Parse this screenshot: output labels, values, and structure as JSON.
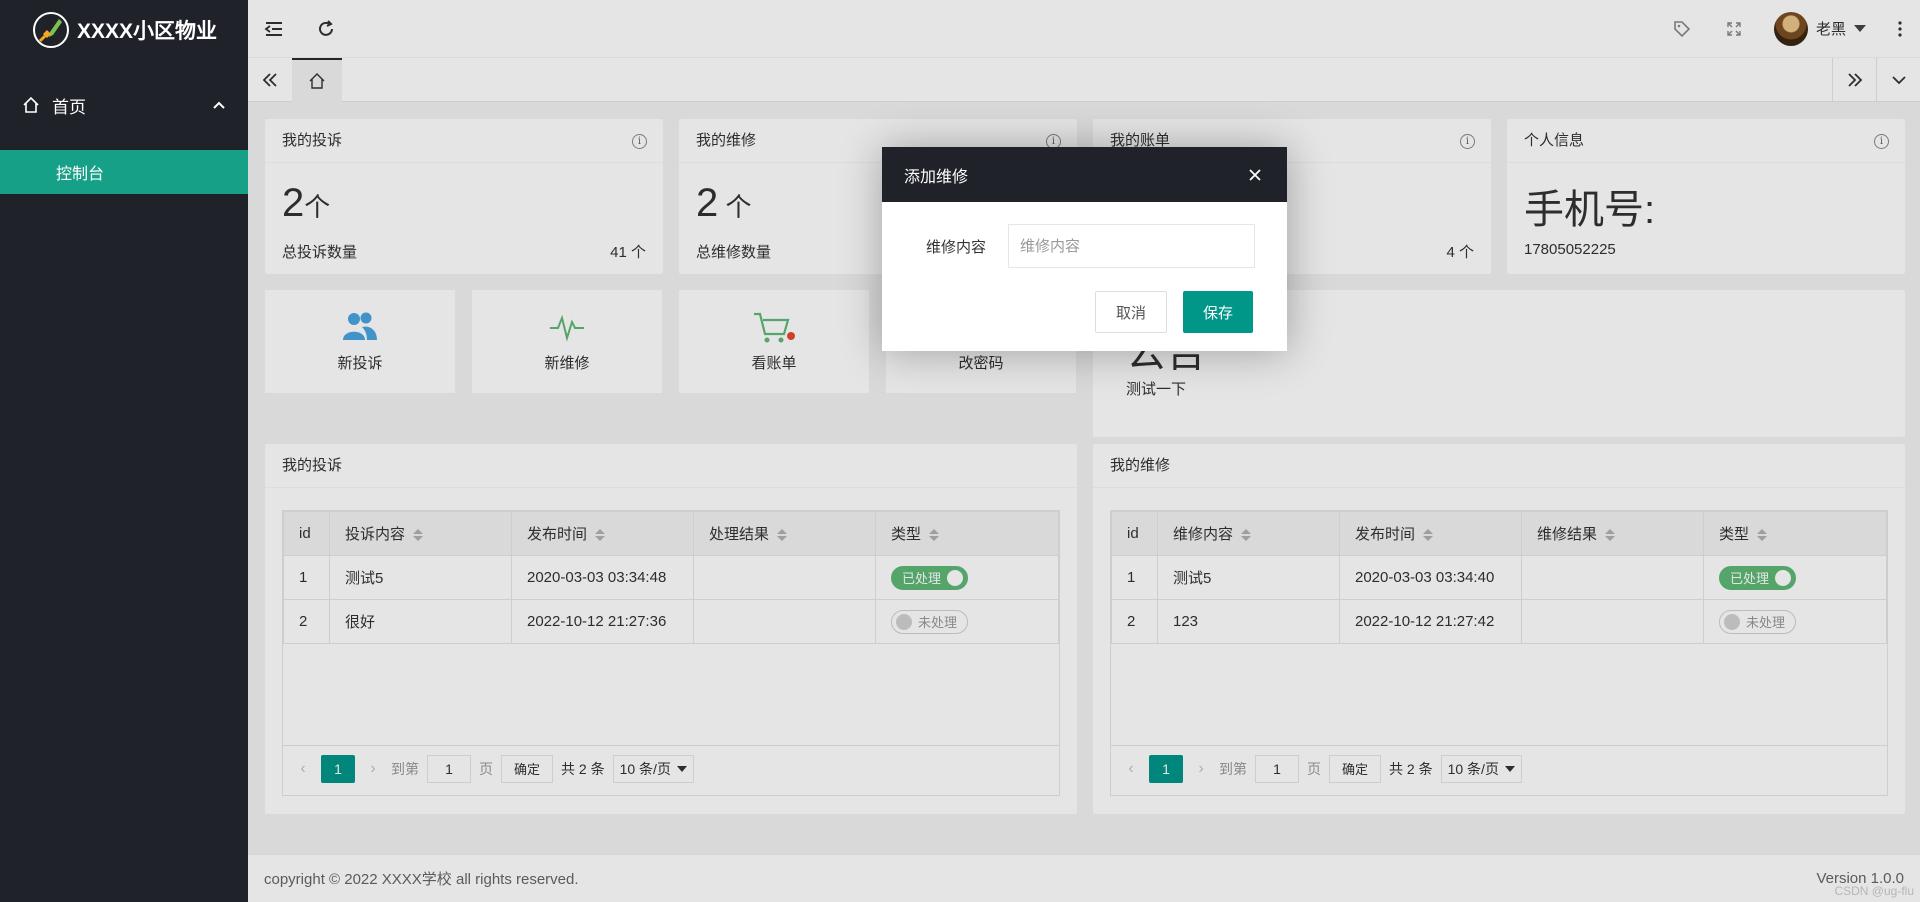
{
  "app": {
    "title": "XXXX小区物业"
  },
  "sidebar": {
    "group_label": "首页",
    "sub_item": "控制台"
  },
  "header": {
    "user_name": "老黑"
  },
  "cards": [
    {
      "title": "我的投诉",
      "big_value": "2",
      "big_unit": "个",
      "label": "总投诉数量",
      "count": "41 个"
    },
    {
      "title": "我的维修",
      "big_value": "2",
      "big_unit": " 个",
      "label": "总维修数量",
      "count": ""
    },
    {
      "title": "我的账单",
      "big_value": "",
      "big_unit": "",
      "label": "",
      "count": "4 个"
    },
    {
      "title": "个人信息",
      "big_value": "手机号:",
      "big_unit": "",
      "label": "17805052225",
      "count": ""
    }
  ],
  "quick": [
    {
      "label": "新投诉",
      "icon": "users-icon"
    },
    {
      "label": "新维修",
      "icon": "pulse-icon"
    },
    {
      "label": "看账单",
      "icon": "cart-icon"
    },
    {
      "label": "改密码",
      "icon": "key-icon"
    }
  ],
  "notice": {
    "title": "公告",
    "text": "测试一下"
  },
  "complaints": {
    "title": "我的投诉",
    "headers": [
      "id",
      "投诉内容",
      "发布时间",
      "处理结果",
      "类型"
    ],
    "rows": [
      {
        "id": "1",
        "content": "测试5",
        "time": "2020-03-03 03:34:48",
        "result": "",
        "status": "已处理",
        "on": true
      },
      {
        "id": "2",
        "content": "很好",
        "time": "2022-10-12 21:27:36",
        "result": "",
        "status": "未处理",
        "on": false
      }
    ]
  },
  "repairs": {
    "title": "我的维修",
    "headers": [
      "id",
      "维修内容",
      "发布时间",
      "维修结果",
      "类型"
    ],
    "rows": [
      {
        "id": "1",
        "content": "测试5",
        "time": "2020-03-03 03:34:40",
        "result": "",
        "status": "已处理",
        "on": true
      },
      {
        "id": "2",
        "content": "123",
        "time": "2022-10-12 21:27:42",
        "result": "",
        "status": "未处理",
        "on": false
      }
    ]
  },
  "pager": {
    "current": "1",
    "goto_label": "到第",
    "goto_value": "1",
    "page_unit": "页",
    "confirm": "确定",
    "total": "共 2 条",
    "page_size": "10 条/页"
  },
  "footer": {
    "copyright": "copyright © 2022 XXXX学校 all rights reserved.",
    "version": "Version 1.0.0",
    "watermark": "CSDN @ug-flu"
  },
  "modal": {
    "title": "添加维修",
    "field_label": "维修内容",
    "field_placeholder": "维修内容",
    "field_value": "",
    "cancel": "取消",
    "save": "保存"
  },
  "colors": {
    "sidebar": "#20222a",
    "accent": "#009688",
    "active_nav": "#16a087",
    "switch_on": "#5fb878"
  }
}
